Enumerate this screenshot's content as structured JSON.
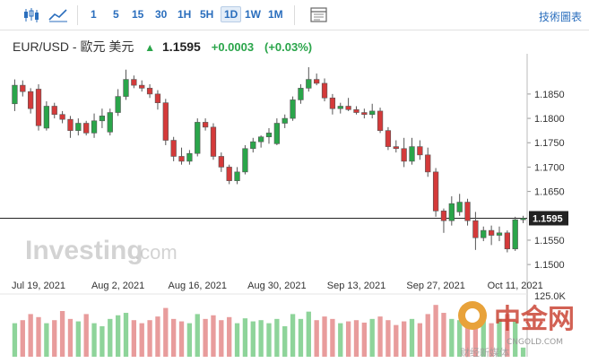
{
  "toolbar": {
    "chart_type_icons": [
      "candlestick-icon",
      "area-chart-icon"
    ],
    "intervals": [
      "1",
      "5",
      "15",
      "30",
      "1H",
      "5H",
      "1D",
      "1W",
      "1M"
    ],
    "active_interval": "1D",
    "settings_icon": "chart-settings-icon",
    "right_link": "技術圖表"
  },
  "quote": {
    "pair": "EUR/USD - 歐元 美元",
    "price": "1.1595",
    "change": "+0.0003",
    "change_pct": "(+0.03%)"
  },
  "colors": {
    "up": "#2aa54a",
    "down": "#d43a3a",
    "vol_up": "#8ed49a",
    "vol_down": "#e89c9c"
  },
  "watermark": {
    "investing": "Investing",
    "dotcom": ".com"
  },
  "overlay_logo": {
    "cn": "中金网",
    "url": "CNGOLD.COM",
    "tagline": "财经新媒体"
  },
  "chart_data": {
    "type": "candlestick",
    "y_ticks": [
      "1.1850",
      "1.1800",
      "1.1750",
      "1.1700",
      "1.1650",
      "1.1550",
      "1.1500"
    ],
    "ylim": [
      1.148,
      1.1905
    ],
    "current_price": "1.1595",
    "x_labels": [
      "Jul 19, 2021",
      "Aug 2, 2021",
      "Aug 16, 2021",
      "Aug 30, 2021",
      "Sep 13, 2021",
      "Sep 27, 2021",
      "Oct 11, 2021"
    ],
    "x_label_index": [
      3,
      13,
      23,
      33,
      43,
      53,
      63
    ],
    "volume_label": "125.0K",
    "ohlc": [
      [
        1.183,
        1.188,
        1.1815,
        1.1868
      ],
      [
        1.1868,
        1.1878,
        1.1845,
        1.1855
      ],
      [
        1.1855,
        1.1862,
        1.181,
        1.182
      ],
      [
        1.186,
        1.187,
        1.1775,
        1.1785
      ],
      [
        1.178,
        1.1835,
        1.1775,
        1.1825
      ],
      [
        1.1825,
        1.1832,
        1.18,
        1.1808
      ],
      [
        1.1808,
        1.1815,
        1.179,
        1.1798
      ],
      [
        1.1798,
        1.1805,
        1.176,
        1.1775
      ],
      [
        1.1775,
        1.18,
        1.1765,
        1.179
      ],
      [
        1.179,
        1.1795,
        1.1765,
        1.177
      ],
      [
        1.177,
        1.181,
        1.176,
        1.1795
      ],
      [
        1.1795,
        1.182,
        1.178,
        1.1805
      ],
      [
        1.1772,
        1.182,
        1.1765,
        1.1812
      ],
      [
        1.1812,
        1.186,
        1.1805,
        1.1845
      ],
      [
        1.1845,
        1.19,
        1.1838,
        1.188
      ],
      [
        1.188,
        1.1888,
        1.1862,
        1.1868
      ],
      [
        1.1868,
        1.1878,
        1.1855,
        1.1862
      ],
      [
        1.1862,
        1.187,
        1.1842,
        1.185
      ],
      [
        1.185,
        1.1858,
        1.1818,
        1.1832
      ],
      [
        1.1832,
        1.184,
        1.1745,
        1.1755
      ],
      [
        1.1755,
        1.1762,
        1.1712,
        1.1722
      ],
      [
        1.1722,
        1.174,
        1.1705,
        1.1712
      ],
      [
        1.1712,
        1.1735,
        1.1705,
        1.1728
      ],
      [
        1.1728,
        1.18,
        1.1722,
        1.1792
      ],
      [
        1.1792,
        1.18,
        1.1775,
        1.1782
      ],
      [
        1.1782,
        1.179,
        1.1715,
        1.1722
      ],
      [
        1.1722,
        1.173,
        1.169,
        1.17
      ],
      [
        1.17,
        1.1705,
        1.1665,
        1.1672
      ],
      [
        1.1672,
        1.17,
        1.1665,
        1.169
      ],
      [
        1.169,
        1.1745,
        1.1685,
        1.1738
      ],
      [
        1.1738,
        1.176,
        1.173,
        1.1752
      ],
      [
        1.1752,
        1.1765,
        1.174,
        1.1762
      ],
      [
        1.1762,
        1.178,
        1.1748,
        1.177
      ],
      [
        1.1748,
        1.18,
        1.1745,
        1.179
      ],
      [
        1.179,
        1.1808,
        1.178,
        1.18
      ],
      [
        1.18,
        1.1845,
        1.1795,
        1.1838
      ],
      [
        1.1838,
        1.187,
        1.183,
        1.1862
      ],
      [
        1.1862,
        1.1905,
        1.1855,
        1.188
      ],
      [
        1.188,
        1.1892,
        1.1868,
        1.1872
      ],
      [
        1.1872,
        1.1882,
        1.1835,
        1.1842
      ],
      [
        1.1842,
        1.185,
        1.1808,
        1.182
      ],
      [
        1.182,
        1.1832,
        1.181,
        1.1825
      ],
      [
        1.1825,
        1.1842,
        1.1815,
        1.1818
      ],
      [
        1.1818,
        1.1825,
        1.1808,
        1.1812
      ],
      [
        1.1812,
        1.182,
        1.18,
        1.1808
      ],
      [
        1.1808,
        1.183,
        1.18,
        1.1815
      ],
      [
        1.1815,
        1.1822,
        1.177,
        1.1775
      ],
      [
        1.1775,
        1.1782,
        1.1735,
        1.1742
      ],
      [
        1.1742,
        1.1755,
        1.173,
        1.1738
      ],
      [
        1.1738,
        1.176,
        1.17,
        1.1712
      ],
      [
        1.1712,
        1.176,
        1.1705,
        1.1742
      ],
      [
        1.1742,
        1.1755,
        1.1715,
        1.1725
      ],
      [
        1.1725,
        1.174,
        1.168,
        1.169
      ],
      [
        1.169,
        1.1698,
        1.1598,
        1.161
      ],
      [
        1.161,
        1.1615,
        1.1565,
        1.159
      ],
      [
        1.159,
        1.164,
        1.158,
        1.1625
      ],
      [
        1.1608,
        1.1645,
        1.16,
        1.1628
      ],
      [
        1.1628,
        1.1635,
        1.158,
        1.159
      ],
      [
        1.159,
        1.1608,
        1.153,
        1.1555
      ],
      [
        1.1555,
        1.1578,
        1.1548,
        1.157
      ],
      [
        1.157,
        1.158,
        1.154,
        1.156
      ],
      [
        1.156,
        1.1578,
        1.1548,
        1.1565
      ],
      [
        1.1565,
        1.157,
        1.1525,
        1.1532
      ],
      [
        1.1532,
        1.1598,
        1.1528,
        1.1592
      ],
      [
        1.1592,
        1.16,
        1.1585,
        1.1595
      ]
    ],
    "volume": [
      0.55,
      0.6,
      0.7,
      0.65,
      0.55,
      0.6,
      0.75,
      0.62,
      0.58,
      0.7,
      0.55,
      0.5,
      0.62,
      0.68,
      0.72,
      0.6,
      0.55,
      0.6,
      0.66,
      0.8,
      0.62,
      0.58,
      0.55,
      0.7,
      0.62,
      0.68,
      0.6,
      0.65,
      0.55,
      0.63,
      0.58,
      0.6,
      0.55,
      0.62,
      0.5,
      0.7,
      0.62,
      0.74,
      0.6,
      0.66,
      0.62,
      0.55,
      0.58,
      0.6,
      0.56,
      0.62,
      0.66,
      0.6,
      0.52,
      0.58,
      0.62,
      0.55,
      0.7,
      0.85,
      0.72,
      0.62,
      0.6,
      0.66,
      0.72,
      0.6,
      0.55,
      0.62,
      0.7,
      0.58,
      0.15
    ]
  }
}
